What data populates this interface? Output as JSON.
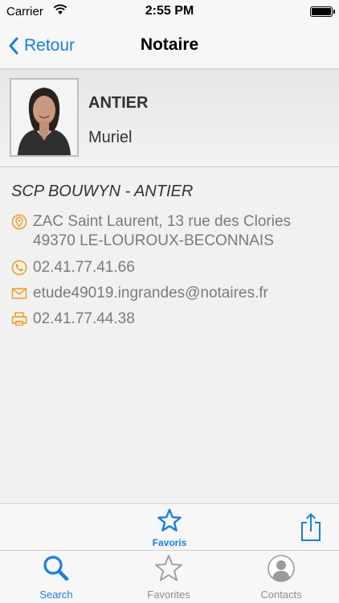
{
  "status_bar": {
    "carrier": "Carrier",
    "time": "2:55 PM"
  },
  "nav": {
    "back_label": "Retour",
    "title": "Notaire"
  },
  "profile": {
    "last_name": "ANTIER",
    "first_name": "Muriel"
  },
  "details": {
    "office": "SCP BOUWYN - ANTIER",
    "address_line1": "ZAC Saint Laurent, 13 rue des Clories",
    "address_line2": "49370 LE-LOUROUX-BECONNAIS",
    "phone": "02.41.77.41.66",
    "email": "etude49019.ingrandes@notaires.fr",
    "fax": "02.41.77.44.38"
  },
  "toolbar": {
    "favorite_label": "Favoris"
  },
  "tabs": [
    {
      "label": "Search",
      "icon": "search-icon",
      "active": true
    },
    {
      "label": "Favorites",
      "icon": "star-icon",
      "active": false
    },
    {
      "label": "Contacts",
      "icon": "contact-icon",
      "active": false
    }
  ],
  "colors": {
    "accent": "#1a7ee0",
    "detail_icon": "#f0a030",
    "detail_text": "#7a7a7a"
  }
}
